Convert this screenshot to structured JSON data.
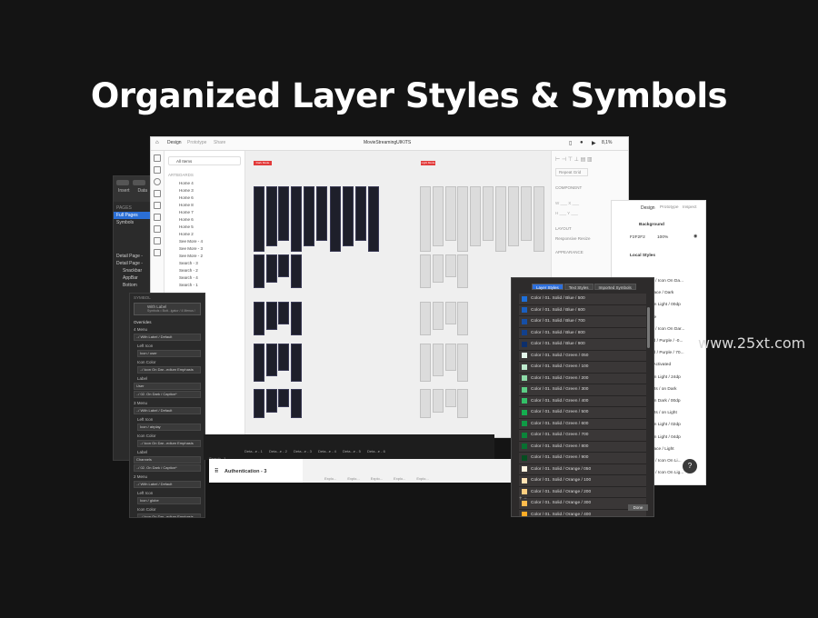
{
  "headline": "Organized Layer Styles & Symbols",
  "watermark": "www.25xt.com",
  "xd": {
    "tabs": [
      "Design",
      "Prototype",
      "Share"
    ],
    "doc_title": "MovieStreamingUIKITS",
    "zoom": "8,1%",
    "search": "All Items",
    "artboards_heading": "ARTBOARDS",
    "artboards": [
      "Home 4",
      "Home 3",
      "Home 6",
      "Home 8",
      "Home 7",
      "Home 6",
      "Home 5",
      "Home 2",
      "See More - 4",
      "See More - 3",
      "See More - 2",
      "Search - 3",
      "Search - 2",
      "Search - 4",
      "Search - 1"
    ],
    "props": {
      "repeat_grid": "Repeat Grid",
      "component": "COMPONENT",
      "layout": "LAYOUT",
      "responsive_resize": "Responsive Resize",
      "appearance": "APPEARANCE"
    },
    "red_labels": [
      "Dark Mode",
      "Light Mode"
    ]
  },
  "sketch": {
    "toolbar": [
      "Insert",
      "Data"
    ],
    "pages_heading": "PAGES",
    "pages": [
      "Full Pages",
      "Symbols"
    ],
    "layers": [
      "Detail Page -",
      "Detail Page -",
      "Snackbar",
      "AppBar",
      "Bottom"
    ]
  },
  "overrides": {
    "symbol_heading": "SYMBOL",
    "symbol_name": "With Label",
    "symbol_path": "Symbols • Bott...igator / 4 Menus /",
    "title": "Overrides",
    "groups": [
      {
        "menu": "4 Menu",
        "value": "../ With Label / Default",
        "left_icon_value": "Icon / user",
        "icon_color_value": "../ Icon On Dar...edium Emphasis",
        "label_value": "User",
        "label_style": "../ 02. On Dark / Caption*"
      },
      {
        "menu": "3 Menu",
        "value": "../ With Label / Default",
        "left_icon_value": "Icon / airplay",
        "icon_color_value": "../ Icon On Dar...edium Emphasis",
        "label_value": "Channels",
        "label_style": "../ 02. On Dark / Caption*"
      },
      {
        "menu": "2 Menu",
        "value": "../ With Label / Default",
        "left_icon_value": "Icon / globe",
        "icon_color_value": "../ Icon On Dar...edium Emphasis"
      }
    ],
    "left_icon": "Left Icon",
    "icon_color": "Icon Color",
    "label": "Label"
  },
  "strip": {
    "frames": [
      "Deta...e - 1",
      "Deta...e - 2",
      "Deta...e - 3",
      "Deta...e - 4",
      "Deta...e - 5",
      "Deta...e - 6"
    ],
    "explore": [
      "Explo...",
      "Explo...",
      "Explo...",
      "Explo...",
      "Explo..."
    ],
    "search": "Search - 1",
    "auth": "Authentication - 3"
  },
  "inspector": {
    "tabs": [
      "Design",
      "Prototype",
      "Inspect"
    ],
    "background_heading": "Background",
    "hex": "F2F2F2",
    "opacity": "100%",
    "local_styles": "Local Styles",
    "items": [
      "..Icon / Icon On Da...",
      "..Surface / Dark",
      "01. On Light / 00dp",
      "..None",
      "..Icon / Icon On Dar...",
      "..Solid / Purple / -0...",
      "..Solid / Purple / 70...",
      "..05. Activated",
      "01. On Light / 24dp",
      "..Inputs / on Dark",
      "02. On Dark / 00dp",
      "..Inputs / on Light",
      "01. On Light / 02dp",
      "01. On Light / 04dp",
      "..Surface / Light",
      "..Icon / Icon On Li...",
      "..Icon / Icon On Lig..."
    ]
  },
  "layer_styles": {
    "tabs": [
      "Layer Styles",
      "Text Styles",
      "Imported Symbols"
    ],
    "done": "Done",
    "items": [
      {
        "name": "Color / 01. Solid / Blue / 500",
        "color": "#1e6fd9"
      },
      {
        "name": "Color / 01. Solid / Blue / 600",
        "color": "#1a5fc0"
      },
      {
        "name": "Color / 01. Solid / Blue / 700",
        "color": "#164fa6"
      },
      {
        "name": "Color / 01. Solid / Blue / 800",
        "color": "#12408c"
      },
      {
        "name": "Color / 01. Solid / Blue / 900",
        "color": "#0d2f6b"
      },
      {
        "name": "Color / 01. Solid / Green / 050",
        "color": "#e3f6ea"
      },
      {
        "name": "Color / 01. Solid / Green / 100",
        "color": "#bde9cd"
      },
      {
        "name": "Color / 01. Solid / Green / 200",
        "color": "#8edaa8"
      },
      {
        "name": "Color / 01. Solid / Green / 300",
        "color": "#5ccc84"
      },
      {
        "name": "Color / 01. Solid / Green / 400",
        "color": "#33bf67"
      },
      {
        "name": "Color / 01. Solid / Green / 500",
        "color": "#14ad4f"
      },
      {
        "name": "Color / 01. Solid / Green / 600",
        "color": "#0f9a45"
      },
      {
        "name": "Color / 01. Solid / Green / 700",
        "color": "#0b853a"
      },
      {
        "name": "Color / 01. Solid / Green / 800",
        "color": "#087030"
      },
      {
        "name": "Color / 01. Solid / Green / 900",
        "color": "#054d20"
      },
      {
        "name": "Color / 01. Solid / Orange / 050",
        "color": "#fff4e0"
      },
      {
        "name": "Color / 01. Solid / Orange / 100",
        "color": "#ffe2b3"
      },
      {
        "name": "Color / 01. Solid / Orange / 200",
        "color": "#ffcf80"
      },
      {
        "name": "Color / 01. Solid / Orange / 300",
        "color": "#ffbb4d"
      },
      {
        "name": "Color / 01. Solid / Orange / 400",
        "color": "#ffac26"
      }
    ]
  },
  "help_button": "?"
}
